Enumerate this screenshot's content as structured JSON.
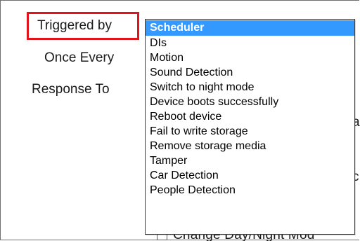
{
  "form": {
    "triggered_by_label": "Triggered by",
    "once_every_label": "Once Every",
    "response_to_label": "Response To"
  },
  "dropdown": {
    "selected_value": "Scheduler",
    "options": [
      {
        "label": "Scheduler",
        "selected": true
      },
      {
        "label": "DIs",
        "selected": false
      },
      {
        "label": "Motion",
        "selected": false
      },
      {
        "label": "Sound Detection",
        "selected": false
      },
      {
        "label": "Switch to night mode",
        "selected": false
      },
      {
        "label": "Device boots successfully",
        "selected": false
      },
      {
        "label": "Reboot device",
        "selected": false
      },
      {
        "label": "Fail to write storage",
        "selected": false
      },
      {
        "label": "Remove storage media",
        "selected": false
      },
      {
        "label": "Tamper",
        "selected": false
      },
      {
        "label": "Car Detection",
        "selected": false
      },
      {
        "label": "People Detection",
        "selected": false
      }
    ]
  },
  "background": {
    "fragment_a": "a",
    "fragment_c": "c",
    "bottom_fragment": "Change Day/Night Mod"
  },
  "colors": {
    "highlight_border": "#e0141b",
    "selected_background": "#3399ff",
    "selected_text": "#ffffff"
  }
}
